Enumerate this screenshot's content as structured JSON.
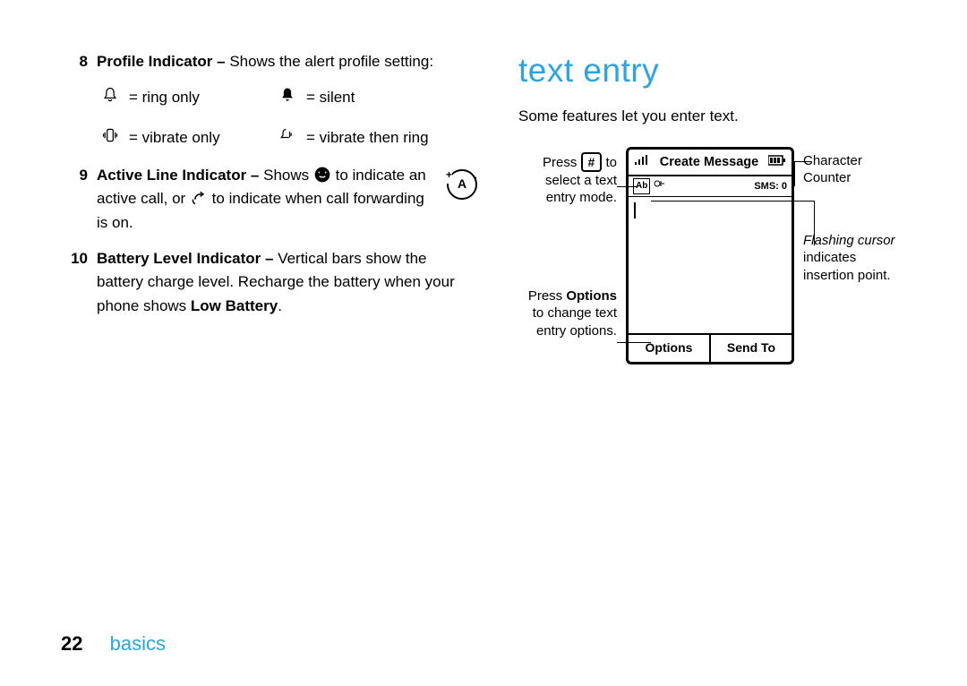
{
  "left": {
    "items": [
      {
        "num": "8",
        "title": "Profile Indicator – ",
        "text": "Shows the alert profile setting:",
        "icons": [
          {
            "id": "ring-only-icon",
            "label": "= ring only"
          },
          {
            "id": "silent-icon",
            "label": "= silent"
          },
          {
            "id": "vibrate-only-icon",
            "label": "= vibrate only"
          },
          {
            "id": "vibe-ring-icon",
            "label": "= vibrate then ring"
          }
        ]
      },
      {
        "num": "9",
        "title": "Active Line Indicator – ",
        "text_a": "Shows ",
        "text_b": " to indicate an active call, or ",
        "text_c": " to indicate when call forwarding is on."
      },
      {
        "num": "10",
        "title": "Battery Level Indicator – ",
        "text_a": "Vertical bars show the battery charge level. Recharge the battery when your phone shows ",
        "low_batt": "Low Battery",
        "text_b": "."
      }
    ]
  },
  "right": {
    "heading": "text entry",
    "intro": "Some features let you enter text.",
    "callout_left_1a": "Press ",
    "hash": "#",
    "callout_left_1b": " to select a text entry mode.",
    "callout_left_2a": "Press ",
    "options_word": "Options",
    "callout_left_2b": " to change text entry options.",
    "phone": {
      "title": "Create Message",
      "mode_indicator": "Ab",
      "sms_counter": "SMS: 0",
      "soft_left": "Options",
      "soft_right": "Send To"
    },
    "callout_right_1": "Character Counter",
    "callout_right_2_italic": "Flashing cursor",
    "callout_right_2_rest": " indicates insertion point."
  },
  "footer": {
    "page": "22",
    "section": "basics"
  }
}
